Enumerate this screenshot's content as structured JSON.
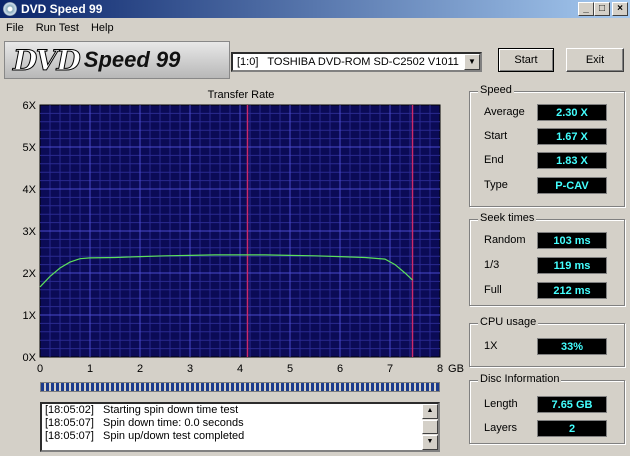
{
  "window": {
    "title": "DVD Speed 99"
  },
  "menu": [
    "File",
    "Run Test",
    "Help"
  ],
  "logo": {
    "part1": "DVD",
    "part2": "Speed 99"
  },
  "drive": {
    "selected": "[1:0]   TOSHIBA DVD-ROM SD-C2502 V1011"
  },
  "buttons": {
    "start": "Start",
    "exit": "Exit"
  },
  "chart_data": {
    "type": "line",
    "title": "Transfer Rate",
    "xlabel": "GB",
    "ylabel": "",
    "xlim": [
      0,
      8
    ],
    "ylim": [
      0,
      6
    ],
    "x_ticks": [
      "0",
      "1",
      "2",
      "3",
      "4",
      "5",
      "6",
      "7",
      "8"
    ],
    "y_ticks": [
      "0X",
      "1X",
      "2X",
      "3X",
      "4X",
      "5X",
      "6X"
    ],
    "markers_gb": [
      4.15,
      7.45
    ],
    "series": [
      {
        "color": "#5ce05c",
        "x": [
          0,
          0.2,
          0.4,
          0.6,
          0.8,
          1.0,
          1.5,
          2.0,
          2.5,
          3.0,
          3.5,
          4.0,
          4.5,
          5.0,
          5.5,
          6.0,
          6.5,
          6.9,
          7.1,
          7.3,
          7.45
        ],
        "y": [
          1.67,
          1.92,
          2.12,
          2.26,
          2.34,
          2.36,
          2.37,
          2.39,
          2.41,
          2.42,
          2.43,
          2.43,
          2.43,
          2.42,
          2.41,
          2.39,
          2.37,
          2.33,
          2.2,
          2.0,
          1.83
        ]
      }
    ],
    "colors": {
      "background": "#0b0b56",
      "grid_major": "#4a4acc",
      "grid_minor": "#2a2a90",
      "marker": "#cc2a6a"
    }
  },
  "log": [
    {
      "time": "[18:05:02]",
      "message": "Starting spin down time test"
    },
    {
      "time": "[18:05:07]",
      "message": "Spin down time: 0.0 seconds"
    },
    {
      "time": "[18:05:07]",
      "message": "Spin up/down test completed"
    }
  ],
  "speed": {
    "title": "Speed",
    "average_label": "Average",
    "average": "2.30 X",
    "start_label": "Start",
    "start": "1.67 X",
    "end_label": "End",
    "end": "1.83 X",
    "type_label": "Type",
    "type": "P-CAV"
  },
  "seek": {
    "title": "Seek times",
    "random_label": "Random",
    "random": "103 ms",
    "third_label": "1/3",
    "third": "119 ms",
    "full_label": "Full",
    "full": "212 ms"
  },
  "cpu": {
    "title": "CPU usage",
    "x1_label": "1X",
    "x1": "33%"
  },
  "disc": {
    "title": "Disc Information",
    "length_label": "Length",
    "length": "7.65 GB",
    "layers_label": "Layers",
    "layers": "2"
  }
}
